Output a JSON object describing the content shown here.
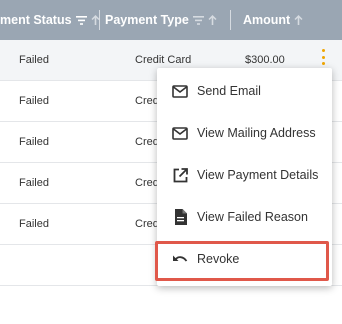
{
  "table": {
    "columns": [
      {
        "label": "ment Status",
        "icons": [
          "filter-icon",
          "sort-up-icon"
        ]
      },
      {
        "label": "Payment Type",
        "icons": [
          "filter-icon",
          "sort-up-icon"
        ]
      },
      {
        "label": "Amount",
        "icons": [
          "sort-up-icon"
        ]
      }
    ],
    "rows": [
      {
        "status": "Failed",
        "payment_type": "Credit Card",
        "amount": "$300.00"
      },
      {
        "status": "Failed",
        "payment_type": "Cred"
      },
      {
        "status": "Failed",
        "payment_type": "Cred"
      },
      {
        "status": "Failed",
        "payment_type": "Cred"
      },
      {
        "status": "Failed",
        "payment_type": "Cred"
      }
    ]
  },
  "row_actions_icon": "more-vertical-icon",
  "context_menu": {
    "items": [
      {
        "label": "Send Email",
        "icon": "mail-icon"
      },
      {
        "label": "View Mailing Address",
        "icon": "mail-icon"
      },
      {
        "label": "View Payment Details",
        "icon": "open-external-icon"
      },
      {
        "label": "View Failed Reason",
        "icon": "document-icon"
      },
      {
        "label": "Revoke",
        "icon": "undo-icon",
        "highlighted": true
      }
    ]
  },
  "colors": {
    "header_bg": "#9aa6b3",
    "accent": "#f0a500",
    "highlight_border": "#e0584a"
  }
}
